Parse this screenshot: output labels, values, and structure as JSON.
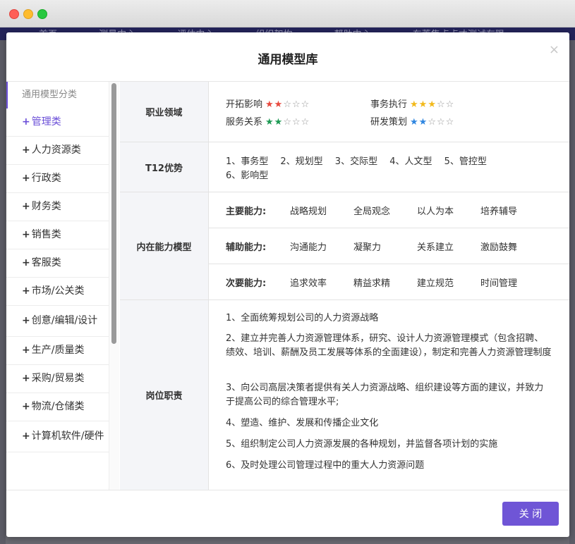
{
  "background_nav": [
    "首页",
    "测量中心",
    "评估中心",
    "组织架构",
    "帮助中心",
    "东莞集点点才测试有限"
  ],
  "modal": {
    "title": "通用模型库",
    "close_symbol": "×",
    "footer_close_label": "关 闭"
  },
  "sidebar": {
    "header": "通用模型分类",
    "items": [
      {
        "label": "管理类",
        "active": true
      },
      {
        "label": "人力资源类"
      },
      {
        "label": "行政类"
      },
      {
        "label": "财务类"
      },
      {
        "label": "销售类"
      },
      {
        "label": "客服类"
      },
      {
        "label": "市场/公关类"
      },
      {
        "label": "创意/编辑/设计"
      },
      {
        "label": "生产/质量类"
      },
      {
        "label": "采购/贸易类"
      },
      {
        "label": "物流/仓储类"
      },
      {
        "label": "计算机软件/硬件"
      }
    ]
  },
  "career_domain": {
    "label": "职业领域",
    "items": [
      {
        "name": "开拓影响",
        "stars": 2,
        "color": "#e8493e"
      },
      {
        "name": "事务执行",
        "stars": 3,
        "color": "#f2b91b"
      },
      {
        "name": "服务关系",
        "stars": 2,
        "color": "#1e9a54"
      },
      {
        "name": "研发策划",
        "stars": 2,
        "color": "#2f86e0"
      }
    ],
    "max_stars": 5
  },
  "t12": {
    "label": "T12优势",
    "line1": "1、事务型　 2、规划型　 3、交际型　 4、人文型　 5、管控型",
    "line2": "6、影响型"
  },
  "competency": {
    "label": "内在能力模型",
    "rows": [
      {
        "key": "主要能力:",
        "values": [
          "战略规划",
          "全局观念",
          "以人为本",
          "培养辅导"
        ]
      },
      {
        "key": "辅助能力:",
        "values": [
          "沟通能力",
          "凝聚力",
          "关系建立",
          "激励鼓舞"
        ]
      },
      {
        "key": "次要能力:",
        "values": [
          "追求效率",
          "精益求精",
          "建立规范",
          "时间管理"
        ]
      }
    ]
  },
  "duties": {
    "label": "岗位职责",
    "items": [
      "1、全面统筹规划公司的人力资源战略",
      "2、建立并完善人力资源管理体系，研究、设计人力资源管理模式（包含招聘、绩效、培训、薪酬及员工发展等体系的全面建设），制定和完善人力资源管理制度",
      "3、向公司高层决策者提供有关人力资源战略、组织建设等方面的建议，并致力于提高公司的综合管理水平;",
      "4、塑造、维护、发展和传播企业文化",
      "5、组织制定公司人力资源发展的各种规划，并监督各项计划的实施",
      "6、及时处理公司管理过程中的重大人力资源问题"
    ]
  }
}
